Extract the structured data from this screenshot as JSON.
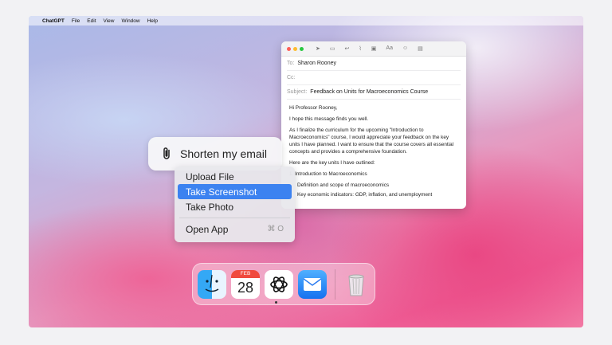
{
  "menubar": {
    "apple_icon": "apple-logo-icon",
    "app": "ChatGPT",
    "items": [
      "File",
      "Edit",
      "View",
      "Window",
      "Help"
    ]
  },
  "prompt": {
    "icon": "paperclip-icon",
    "text": "Shorten my email"
  },
  "attach_menu": {
    "items": [
      {
        "label": "Upload File"
      },
      {
        "label": "Take Screenshot",
        "selected": true
      },
      {
        "label": "Take Photo"
      }
    ],
    "open_app": {
      "label": "Open App",
      "shortcut": "⌘ O"
    }
  },
  "mail": {
    "to_label": "To:",
    "to_value": "Sharon Rooney",
    "cc_label": "Cc:",
    "subject_label": "Subject:",
    "subject_value": "Feedback on Units for Macroeconomics Course",
    "greeting": "Hi Professor Rooney,",
    "line1": "I hope this message finds you well.",
    "para": "As I finalize the curriculum for the upcoming \"Introduction to Macroeconomics\" course, I would appreciate your feedback on the key units I have planned. I want to ensure that the course covers all essential concepts and provides a comprehensive foundation.",
    "outline_intro": "Here are the key units I have outlined:",
    "unit1": "1. Introduction to Macroeconomics",
    "bullets": [
      "Definition and scope of macroeconomics",
      "Key economic indicators: GDP, inflation, and unemployment"
    ],
    "toolbar_icons": [
      "send-icon",
      "header-fields-icon",
      "reply-icon",
      "attachment-icon",
      "markup-icon",
      "format-icon",
      "emoji-icon",
      "photo-browser-icon"
    ]
  },
  "dock": {
    "calendar_month": "FEB",
    "calendar_day": "28"
  },
  "colors": {
    "selection": "#3c82f0",
    "close": "#ff5f57",
    "minimize": "#febc2e",
    "zoom": "#28c840"
  }
}
